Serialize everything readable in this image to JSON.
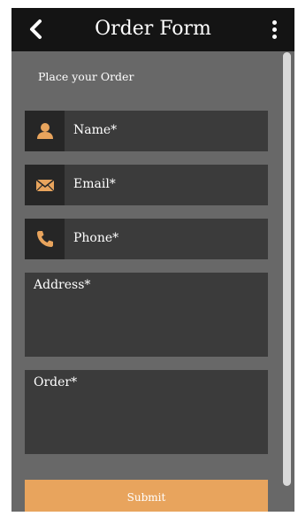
{
  "topbar": {
    "title": "Order Form",
    "back_icon": "chevron-left-icon",
    "menu_icon": "more-vertical-icon",
    "background": "#141414"
  },
  "form": {
    "heading": "Place your Order",
    "fields": [
      {
        "icon": "user-icon",
        "placeholder": "Name*"
      },
      {
        "icon": "mail-icon",
        "placeholder": "Email*"
      },
      {
        "icon": "phone-icon",
        "placeholder": "Phone*"
      }
    ],
    "address_placeholder": "Address*",
    "order_placeholder": "Order*",
    "submit_label": "Submit"
  },
  "colors": {
    "accent": "#e8a45d",
    "screen_background": "#686868",
    "field_background": "#3b3b3b",
    "icon_box_background": "#262626"
  }
}
